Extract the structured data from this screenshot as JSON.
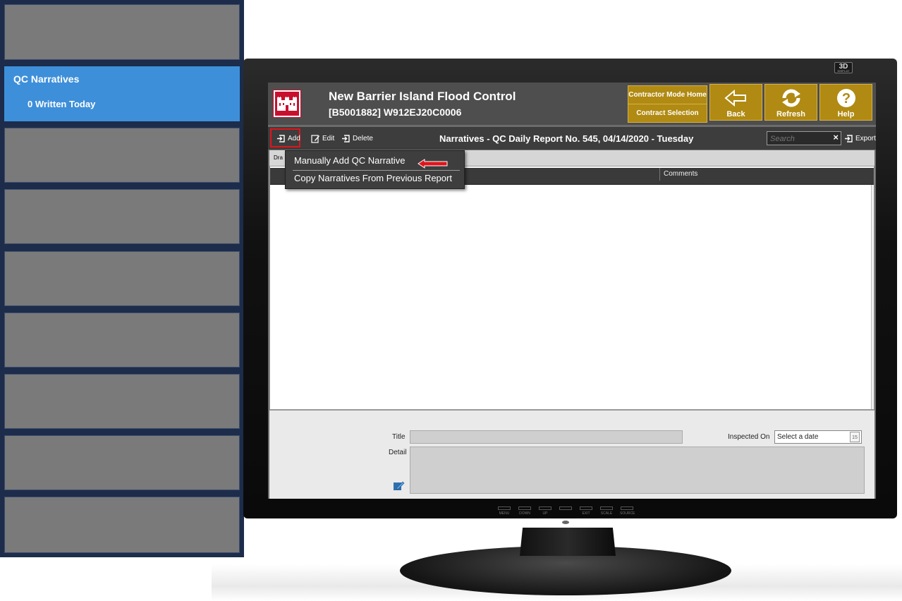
{
  "sidebar": {
    "active": {
      "title": "QC Narratives",
      "subtitle": "0 Written Today"
    }
  },
  "monitor": {
    "badge": "3D",
    "buttons": [
      "MENU",
      "DOWN",
      "UP",
      "",
      "EXIT",
      "SCALE",
      "SOURCE"
    ]
  },
  "header": {
    "title": "New Barrier Island Flood Control",
    "subtitle": "[B5001882] W912EJ20C0006",
    "contractor_mode": "Contractor Mode Home",
    "contract_selection": "Contract Selection",
    "back": "Back",
    "refresh": "Refresh",
    "help": "Help",
    "accent": "#b08a12"
  },
  "toolbar": {
    "add": "Add",
    "edit": "Edit",
    "delete": "Delete",
    "title": "Narratives - QC Daily Report No. 545, 04/14/2020 - Tuesday",
    "search_placeholder": "Search",
    "export": "Export"
  },
  "grid": {
    "tab_label": "Dra",
    "column_comments": "Comments"
  },
  "details": {
    "title_label": "Title",
    "detail_label": "Detail",
    "inspected_on_label": "Inspected On",
    "date_placeholder": "Select a date",
    "calendar_day": "15"
  },
  "dropdown": {
    "items": [
      "Manually Add QC Narrative",
      "Copy Narratives From Previous Report"
    ]
  }
}
